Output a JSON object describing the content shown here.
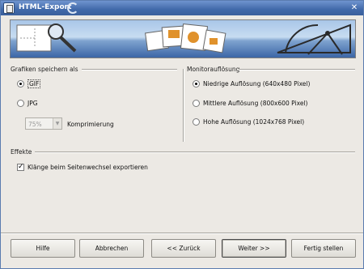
{
  "window": {
    "title": "HTML-Export",
    "close_glyph": "✕"
  },
  "graphics": {
    "group_title": "Grafiken speichern als",
    "options": [
      {
        "label": "GIF",
        "checked": true
      },
      {
        "label": "JPG",
        "checked": false
      }
    ],
    "quality_value": "75%",
    "quality_label": "Komprimierung"
  },
  "monitor": {
    "group_title": "Monitorauflösung",
    "options": [
      {
        "label": "Niedrige Auflösung (640x480 Pixel)",
        "checked": true
      },
      {
        "label": "Mittlere Auflösung (800x600 Pixel)",
        "checked": false
      },
      {
        "label": "Hohe Auflösung (1024x768 Pixel)",
        "checked": false
      }
    ]
  },
  "effects": {
    "group_title": "Effekte",
    "checkbox_label": "Klänge beim Seitenwechsel exportieren",
    "checked": true
  },
  "buttons": {
    "help": "Hilfe",
    "cancel": "Abbrechen",
    "back": "<< Zurück",
    "next": "Weiter >>",
    "finish": "Fertig stellen"
  },
  "icons": [
    "app-icon",
    "title-swirl-icon",
    "close-icon",
    "magnifier-icon",
    "chart-pages-icon",
    "drafting-compass-icon"
  ]
}
